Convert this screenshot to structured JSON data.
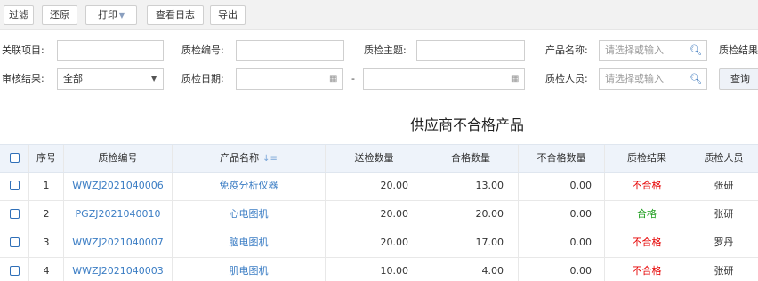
{
  "toolbar": {
    "filter_label": "过滤",
    "restore_label": "还原",
    "print_label": "打印",
    "log_label": "查看日志",
    "export_label": "导出"
  },
  "form": {
    "related_project_label": "关联项目:",
    "related_project_value": "",
    "inspection_no_label": "质检编号:",
    "inspection_no_value": "",
    "inspection_subject_label": "质检主题:",
    "inspection_subject_value": "",
    "product_name_label": "产品名称:",
    "product_name_placeholder": "请选择或输入",
    "inspection_result_label": "质检结果",
    "review_result_label": "审核结果:",
    "review_result_value": "全部",
    "inspection_date_label": "质检日期:",
    "date_separator": "-",
    "inspector_label": "质检人员:",
    "inspector_placeholder": "请选择或输入",
    "query_label": "查询"
  },
  "page_title": "供应商不合格产品",
  "table": {
    "headers": {
      "no": "序号",
      "code": "质检编号",
      "product": "产品名称",
      "sent_qty": "送检数量",
      "pass_qty": "合格数量",
      "fail_qty": "不合格数量",
      "result": "质检结果",
      "inspector": "质检人员"
    },
    "rows": [
      {
        "no": "1",
        "code": "WWZJ2021040006",
        "product": "免疫分析仪器",
        "sent_qty": "20.00",
        "pass_qty": "13.00",
        "fail_qty": "0.00",
        "result": "不合格",
        "inspector": "张研"
      },
      {
        "no": "2",
        "code": "PGZJ2021040010",
        "product": "心电图机",
        "sent_qty": "20.00",
        "pass_qty": "20.00",
        "fail_qty": "0.00",
        "result": "合格",
        "inspector": "张研"
      },
      {
        "no": "3",
        "code": "WWZJ2021040007",
        "product": "脑电图机",
        "sent_qty": "20.00",
        "pass_qty": "17.00",
        "fail_qty": "0.00",
        "result": "不合格",
        "inspector": "罗丹"
      },
      {
        "no": "4",
        "code": "WWZJ2021040003",
        "product": "肌电图机",
        "sent_qty": "10.00",
        "pass_qty": "4.00",
        "fail_qty": "0.00",
        "result": "不合格",
        "inspector": "张研"
      }
    ]
  },
  "colors": {
    "fail": "#e60000",
    "pass": "#1a9c1a",
    "link": "#3b7dc4",
    "header_bg": "#eef3fa"
  }
}
